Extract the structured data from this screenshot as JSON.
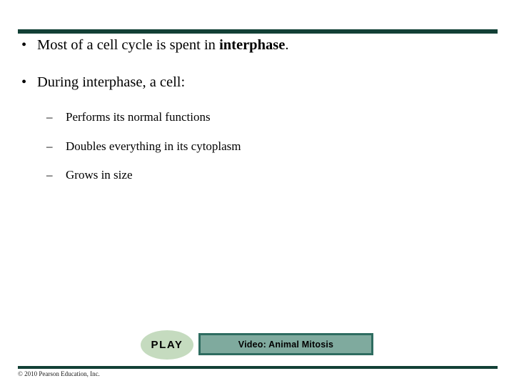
{
  "slide": {
    "background_color": "#ffffff",
    "accent_color": "#124036",
    "rules": {
      "top_name": "top-divider-rule",
      "bottom_name": "bottom-divider-rule"
    },
    "bullets": [
      {
        "level": 1,
        "marker": "•",
        "text_before": "Most of a cell cycle is spent in ",
        "bold_text": "interphase",
        "text_after": "."
      },
      {
        "level": 1,
        "marker": "•",
        "text_before": "During interphase, a cell:",
        "bold_text": "",
        "text_after": ""
      }
    ],
    "sub_bullets": [
      {
        "level": 2,
        "marker": "–",
        "text": "Performs its normal functions"
      },
      {
        "level": 2,
        "marker": "–",
        "text": "Doubles everything in its cytoplasm"
      },
      {
        "level": 2,
        "marker": "–",
        "text": "Grows in size"
      }
    ],
    "media": {
      "play_label": "PLAY",
      "play_fill_color": "#c5dbbf",
      "video_label": "Video: Animal Mitosis",
      "video_fill_color": "#7faa9e",
      "video_border_color": "#2e6c60"
    },
    "footer": {
      "copyright": "© 2010 Pearson Education, Inc."
    }
  }
}
